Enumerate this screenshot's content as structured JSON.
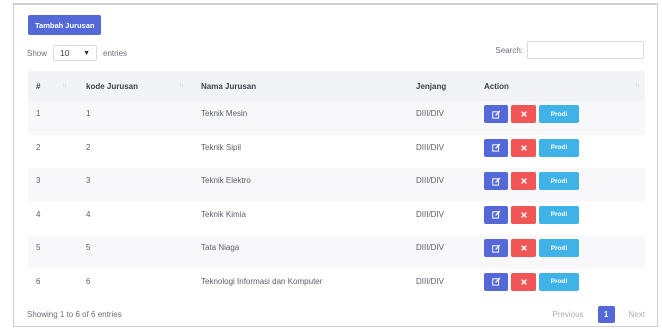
{
  "add_button": "Tambah Jurusan",
  "length": {
    "show": "Show",
    "value": "10",
    "entries": "entries"
  },
  "search": {
    "label": "Search:"
  },
  "columns": {
    "no": "#",
    "kode": "kode Jurusan",
    "nama": "Nama Jurusan",
    "jenjang": "Jenjang",
    "action": "Action"
  },
  "rows": [
    {
      "no": "1",
      "kode": "1",
      "nama": "Teknik Mesin",
      "jenjang": "DIII/DIV"
    },
    {
      "no": "2",
      "kode": "2",
      "nama": "Teknik Sipil",
      "jenjang": "DIII/DIV"
    },
    {
      "no": "3",
      "kode": "3",
      "nama": "Teknik Elektro",
      "jenjang": "DIII/DIV"
    },
    {
      "no": "4",
      "kode": "4",
      "nama": "Teknik Kimia",
      "jenjang": "DIII/DIV"
    },
    {
      "no": "5",
      "kode": "5",
      "nama": "Tata Niaga",
      "jenjang": "DIII/DIV"
    },
    {
      "no": "6",
      "kode": "6",
      "nama": "Teknologi Informasi dan Komputer",
      "jenjang": "DIII/DIV"
    }
  ],
  "row_actions": {
    "edit_icon": "edit-icon",
    "delete_icon": "times-icon",
    "prodi": "Prodi"
  },
  "info": "Showing 1 to 6 of 6 entries",
  "pagination": {
    "previous": "Previous",
    "page": "1",
    "next": "Next"
  },
  "colors": {
    "primary": "#5568d8",
    "danger": "#f25555",
    "info": "#3fb3e8"
  }
}
